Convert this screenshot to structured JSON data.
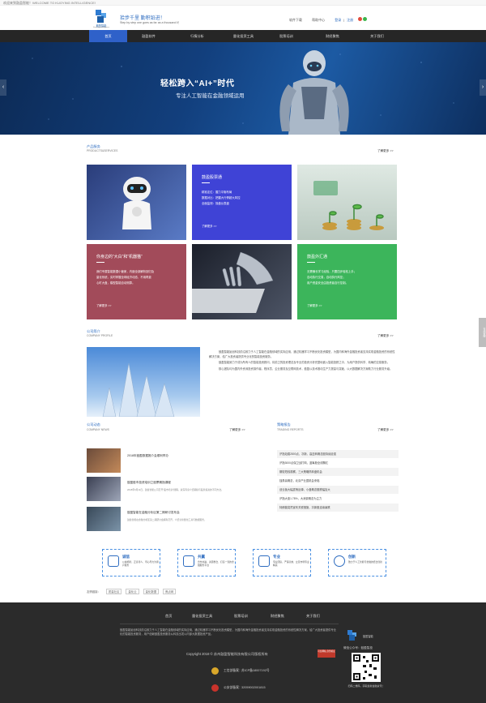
{
  "topbar": {
    "text": "欢迎来到鼓盈智能！WELCOME TO KUOYING INTELLIGENCE!"
  },
  "header": {
    "logo_name": "鼓盈智能",
    "logo_en": "KuoYing Intelligence",
    "slogan": "拾步千里  勤积铅进！",
    "slogan_en": "Step by step one goes as far as a thousand li！",
    "links": [
      "软件下载",
      "帮助中心"
    ],
    "login": "登录",
    "register": "注册"
  },
  "nav": {
    "items": [
      "首页",
      "鼓盈软件",
      "行情分析",
      "量化投资工具",
      "股票培训",
      "财经聚焦",
      "关于我们"
    ],
    "active_index": 0
  },
  "banner": {
    "title": "轻松跨入“AI+”时代",
    "subtitle": "专注人工智能在金融领域运用",
    "prev": "‹",
    "next": "›"
  },
  "products": {
    "title": "产品服务",
    "subtitle": "PRODUCTS&SERVICES",
    "more": "了解更多 >>",
    "tiles": [
      {
        "title": "鼓盈股票通",
        "lines": [
          "精准定位：握力平衡布局",
          "数据对比：把握大行情超大风控",
          "全面监测：操盘仪表盘"
        ],
        "more": "了解更多 >>"
      },
      {
        "title": "你身边的“大白”和“机器猫”",
        "lines": [
          "我们专属智能数据小管家，内嵌全部解析回归及",
          "量化系统，实时掌握全球经济动态，不用再费",
          "心盯大盘，模型智能自动测算。"
        ],
        "more": "了解更多 >>"
      },
      {
        "title": "鼓盈外汇通",
        "lines": [
          "无需懂长学习经验，只要四步轻松上手；",
          "自动执行交易，自动执行风控；",
          "用户资金安全由投资者自行控制。"
        ],
        "more": "了解更多 >>"
      }
    ]
  },
  "company": {
    "title": "公司简介",
    "subtitle": "COMPANY PROFILE",
    "more": "了解更多 >>",
    "paragraphs": [
      "鼓盈智能始创科技前沿致力于人工智能在金融领域的实际应用，通过机器学习不断优化投资模型，为国内和海外金融投资者支持实现金融投资的系统性解决方案，给广大投资者提供专业化的智能投资服务。",
      "鼓盈智能致力于成为所有人的智能投资顾问，将前卫的投资理念及专业的投资分析完整地嵌入智能投顾之中，为用户提供科学、精确的交易服务。",
      "核心团队均为国内外资深投资操作者、程序员、企业服务及互联网技术，鼓盈以技术推动生产力提高与突破，以大数据解决方案助力行业服务升级。"
    ]
  },
  "news": {
    "title": "公司动态",
    "subtitle": "COMPANY NEWS",
    "more": "了解更多 >>",
    "items": [
      {
        "title": "2018年鼓盈数据推介会顺利举办",
        "desc": ""
      },
      {
        "title": "鼓盈股市投资培训之股票期指课程",
        "desc": "2018年9月11日，鼓盈智能公司召开“股市培训”课程，资深专家介绍期指与股票投资的不同方法。"
      },
      {
        "title": "鼓盈智能在金融分析区第二期研讨发布会",
        "desc": "鼓盈智能在金融分析区第二期研讨会顺利召开，介绍全新量化工具与数据服务。"
      }
    ]
  },
  "reports": {
    "title": "策略报告",
    "subtitle": "TRADING REPORTS",
    "more": "了解更多 >>",
    "items": [
      "沪指站稳2800点，次新、高送转概念股持续走强",
      "沪指3000点保卫战打响，蓝筹股全线飘红",
      "期权短线观察，三大策略抓转盘机会",
      "独角兽概念，北京产业园机会来临",
      "创业板大幅震荡反弹，小盘概念股跌幅加大",
      "沪指大涨1.78%，大消费概念为主力",
      "特朗普突然宣布关税措施，次新股连续暴跌"
    ]
  },
  "badges": [
    {
      "title": "诚信",
      "desc": "公诚相待，正直待人、尽心尽力为用户服务"
    },
    {
      "title": "共赢",
      "desc": "合作共赢，资源整合、打造一流的金融服务平台"
    },
    {
      "title": "专业",
      "desc": "专业团队，严谨高效、立足市场专业精英"
    },
    {
      "title": "创新",
      "desc": "致力于人工智能与金融的结合创新"
    }
  ],
  "friend_links": {
    "label": "友情链接：",
    "items": [
      "质量社区",
      "量化云",
      "量化数据",
      "焦点网"
    ]
  },
  "footer": {
    "nav": [
      "首页",
      "量化投资工具",
      "股票培训",
      "财经聚焦",
      "关于我们"
    ],
    "desc": "鼓盈智能始创科技前沿致力于人工智能在金融领域的实际应用，通过机器学习不断优化投资模型，为国内和海外金融投资者支持实现金融投资的系统性解决方案，给广大投资者提供专业化的智能投资服务，用户信赖鼓盈投资服务从科技出发以内部大数据投资产品。",
    "copyright": "Copyright 2018 © 苏州鼓盈智能科技有限公司版权所有",
    "icp_label": "工信部备案：",
    "icp_no": "苏ICP备18007192号",
    "police_label": "公安部备案：",
    "police_no": "32059002001815",
    "wechat": "微信公众号：鼓盈智投",
    "qr_text": "扫码二维码，获取最新金融资讯！",
    "badge_text": "可信网站 身份验证"
  },
  "side_tab": "在线客服"
}
